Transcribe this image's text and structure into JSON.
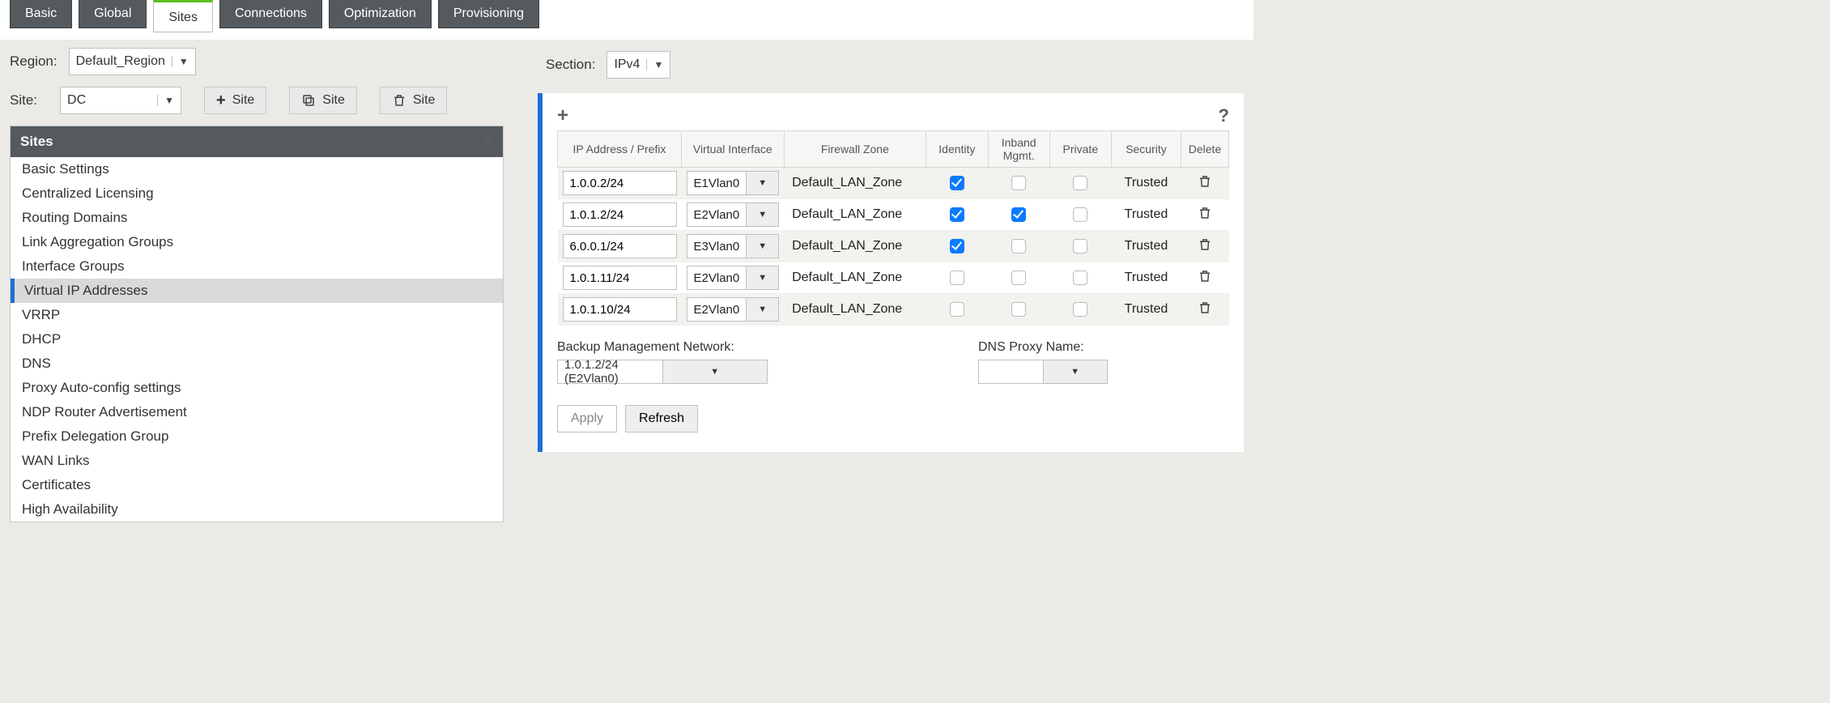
{
  "tabs": [
    "Basic",
    "Global",
    "Sites",
    "Connections",
    "Optimization",
    "Provisioning"
  ],
  "active_tab": "Sites",
  "left": {
    "region_label": "Region:",
    "region_value": "Default_Region",
    "site_label": "Site:",
    "site_value": "DC",
    "btn_add": "Site",
    "btn_clone": "Site",
    "btn_delete": "Site",
    "tree_title": "Sites",
    "tree_items": [
      "Basic Settings",
      "Centralized Licensing",
      "Routing Domains",
      "Link Aggregation Groups",
      "Interface Groups",
      "Virtual IP Addresses",
      "VRRP",
      "DHCP",
      "DNS",
      "Proxy Auto-config settings",
      "NDP Router Advertisement",
      "Prefix Delegation Group",
      "WAN Links",
      "Certificates",
      "High Availability"
    ],
    "tree_selected": "Virtual IP Addresses"
  },
  "right": {
    "section_label": "Section:",
    "section_value": "IPv4",
    "columns": {
      "ip": "IP Address / Prefix",
      "vif": "Virtual Interface",
      "zone": "Firewall Zone",
      "identity": "Identity",
      "inband": "Inband Mgmt.",
      "private": "Private",
      "security": "Security",
      "delete": "Delete"
    },
    "rows": [
      {
        "ip": "1.0.0.2/24",
        "vif": "E1Vlan0",
        "zone": "Default_LAN_Zone",
        "identity": true,
        "inband": false,
        "private": false,
        "security": "Trusted"
      },
      {
        "ip": "1.0.1.2/24",
        "vif": "E2Vlan0",
        "zone": "Default_LAN_Zone",
        "identity": true,
        "inband": true,
        "private": false,
        "security": "Trusted"
      },
      {
        "ip": "6.0.0.1/24",
        "vif": "E3Vlan0",
        "zone": "Default_LAN_Zone",
        "identity": true,
        "inband": false,
        "private": false,
        "security": "Trusted"
      },
      {
        "ip": "1.0.1.11/24",
        "vif": "E2Vlan0",
        "zone": "Default_LAN_Zone",
        "identity": false,
        "inband": false,
        "private": false,
        "security": "Trusted"
      },
      {
        "ip": "1.0.1.10/24",
        "vif": "E2Vlan0",
        "zone": "Default_LAN_Zone",
        "identity": false,
        "inband": false,
        "private": false,
        "security": "Trusted"
      }
    ],
    "backup_label": "Backup Management Network:",
    "backup_value": "1.0.1.2/24 (E2Vlan0)",
    "dnsproxy_label": "DNS Proxy Name:",
    "dnsproxy_value": "",
    "apply": "Apply",
    "refresh": "Refresh"
  }
}
